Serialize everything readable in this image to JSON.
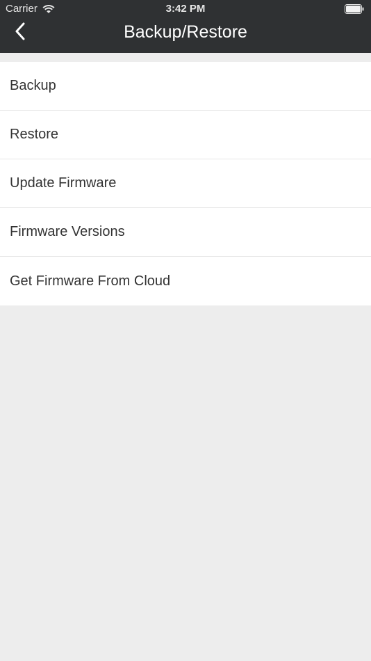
{
  "status_bar": {
    "carrier": "Carrier",
    "time": "3:42 PM",
    "wifi_icon": "wifi-icon",
    "battery_icon": "battery-icon"
  },
  "nav": {
    "title": "Backup/Restore",
    "back_icon": "chevron-left-icon"
  },
  "menu": {
    "items": [
      {
        "label": "Backup"
      },
      {
        "label": "Restore"
      },
      {
        "label": "Update Firmware"
      },
      {
        "label": "Firmware Versions"
      },
      {
        "label": "Get Firmware From Cloud"
      }
    ]
  },
  "colors": {
    "header_bg": "#2f3133",
    "page_bg": "#ededed",
    "list_bg": "#ffffff",
    "separator": "#e6e6e6",
    "text": "#333333"
  }
}
